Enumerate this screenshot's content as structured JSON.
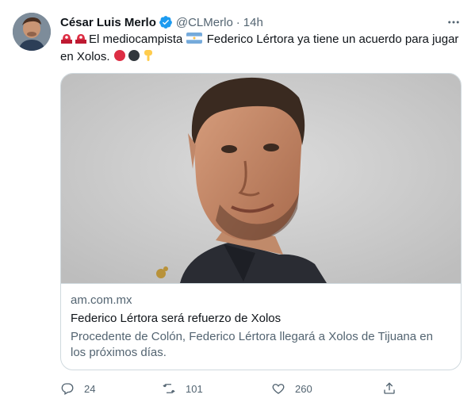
{
  "tweet": {
    "author_name": "César Luis Merlo",
    "handle": "@CLMerlo",
    "separator": "·",
    "time": "14h",
    "more_icon": "ellipsis-icon",
    "text_main": "El mediocampista",
    "text_rest": " Federico Lértora ya tiene un acuerdo para jugar en Xolos.",
    "emojis": [
      "siren",
      "siren",
      "argentina-flag",
      "red-circle",
      "black-circle",
      "point-down"
    ]
  },
  "card": {
    "domain": "am.com.mx",
    "title": "Federico Lértora será refuerzo de Xolos",
    "description": "Procedente de Colón, Federico Lértora llegará a Xolos de Tijuana en los próximos días."
  },
  "actions": {
    "reply_count": "24",
    "retweet_count": "101",
    "like_count": "260"
  },
  "colors": {
    "verified": "#1d9bf0",
    "muted_text": "#536471",
    "border": "#cfd9de"
  }
}
